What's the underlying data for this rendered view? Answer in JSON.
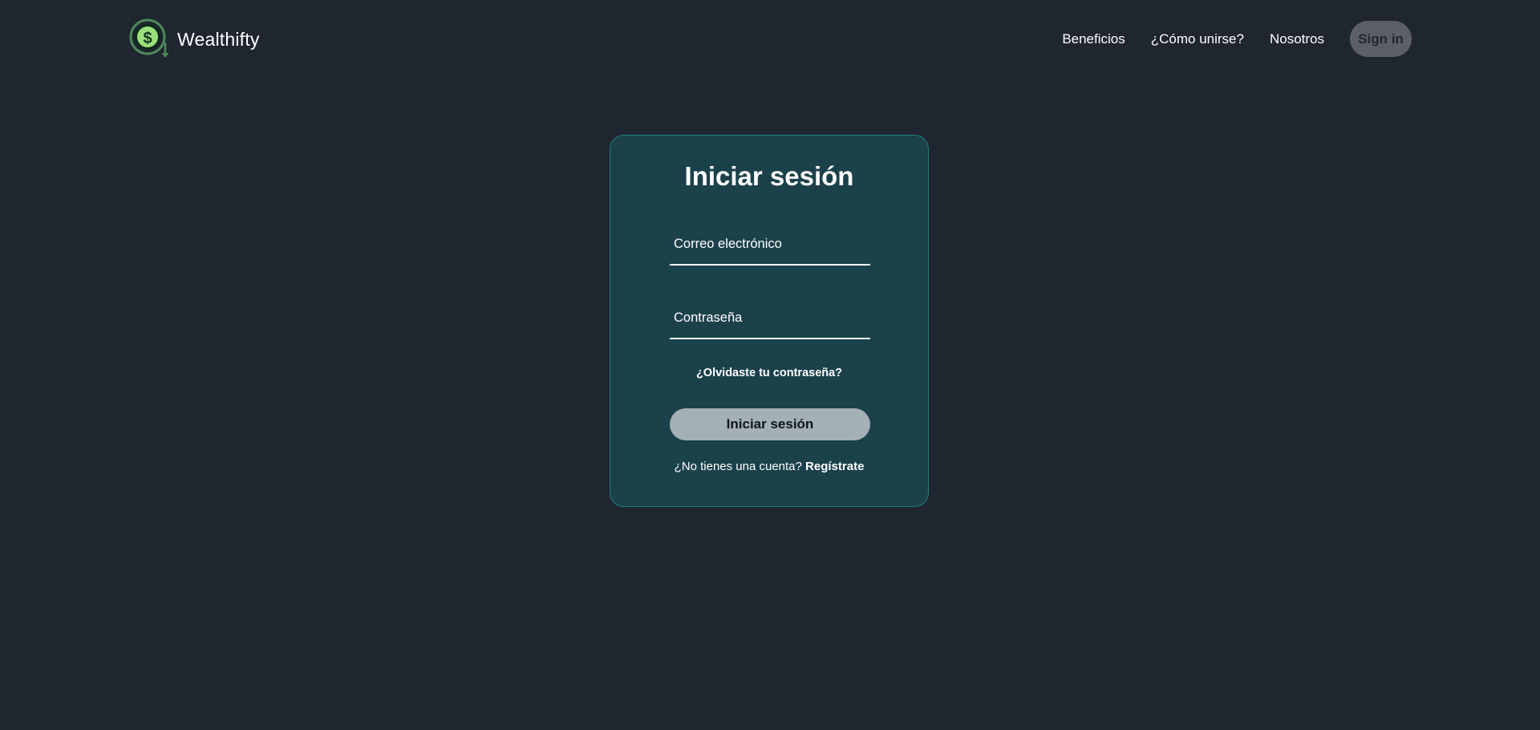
{
  "header": {
    "brand_name": "Wealthifty",
    "logo_icon": "dollar-coin-icon",
    "nav": [
      {
        "label": "Beneficios"
      },
      {
        "label": "¿Cómo unirse?"
      },
      {
        "label": "Nosotros"
      }
    ],
    "signin_label": "Sign in"
  },
  "login": {
    "title": "Iniciar sesión",
    "email_placeholder": "Correo electrónico",
    "email_value": "",
    "password_placeholder": "Contraseña",
    "password_value": "",
    "forgot_label": "¿Olvidaste tu contraseña?",
    "submit_label": "Iniciar sesión",
    "no_account_text": "¿No tienes una cuenta?",
    "register_label": "Regístrate"
  },
  "colors": {
    "background": "#1f2630",
    "card": "#1b414b",
    "card_border": "#1d7f7b",
    "button": "#a3b0b5",
    "signin_button": "#5b6068",
    "logo_accent": "#9be07a"
  }
}
